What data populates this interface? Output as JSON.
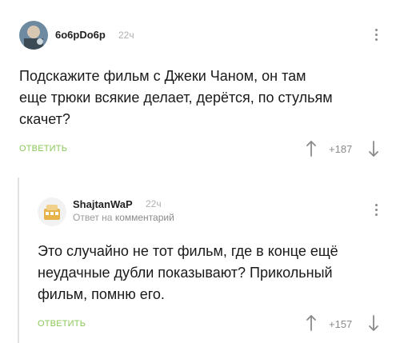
{
  "comments": [
    {
      "author": "6o6pDo6p",
      "time": "22ч",
      "text_lines": [
        "Подскажите фильм с Джеки Чаном, он там",
        "еще трюки всякие делает, дерётся, по стульям",
        "скачет?"
      ],
      "reply_label": "ОТВЕТИТЬ",
      "score": "+187"
    },
    {
      "author": "ShajtanWaP",
      "time": "22ч",
      "subline_prefix": "Ответ на",
      "subline_link": "комментарий",
      "text_lines": [
        "Это случайно не тот фильм, где в конце ещё",
        "неудачные дубли показывают? Прикольный",
        "фильм, помню его."
      ],
      "reply_label": "ОТВЕТИТЬ",
      "score": "+157"
    }
  ],
  "colors": {
    "accent_green": "#8ac858",
    "muted_gray": "#8a8a8a",
    "thread_line": "#e2e2e2"
  },
  "icons": [
    "avatar",
    "more-vertical-icon",
    "arrow-up-icon",
    "arrow-down-icon"
  ]
}
